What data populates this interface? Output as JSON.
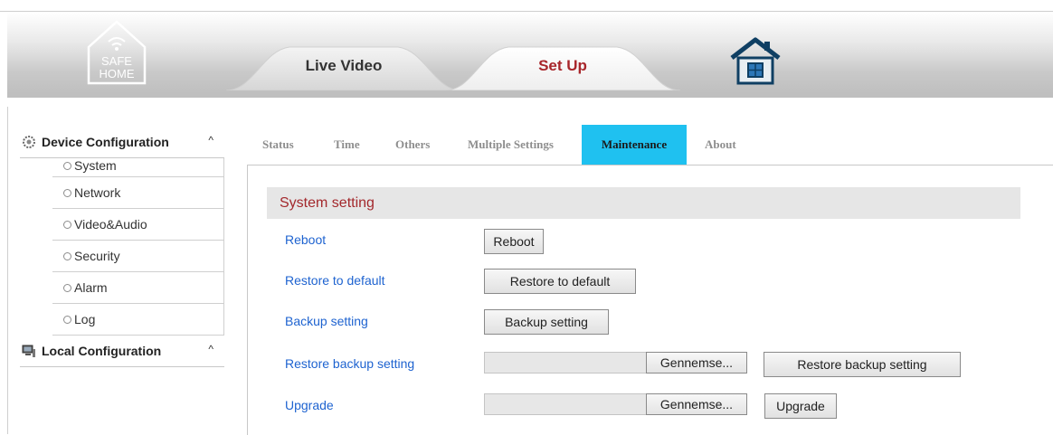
{
  "header": {
    "logo_text_line1": "SAFE",
    "logo_text_line2": "HOME",
    "tabs": [
      {
        "label": "Live Video"
      },
      {
        "label": "Set Up"
      }
    ]
  },
  "sidebar": {
    "device_configuration": {
      "label": "Device Configuration",
      "caret": "^",
      "items": [
        {
          "label": "System"
        },
        {
          "label": "Network"
        },
        {
          "label": "Video&Audio"
        },
        {
          "label": "Security"
        },
        {
          "label": "Alarm"
        },
        {
          "label": "Log"
        }
      ]
    },
    "local_configuration": {
      "label": "Local Configuration",
      "caret": "^"
    }
  },
  "subtabs": [
    {
      "label": "Status"
    },
    {
      "label": "Time"
    },
    {
      "label": "Others"
    },
    {
      "label": "Multiple Settings"
    },
    {
      "label": "Maintenance",
      "active": true
    },
    {
      "label": "About"
    }
  ],
  "section": {
    "title": "System setting"
  },
  "rows": {
    "reboot": {
      "label": "Reboot",
      "button": "Reboot"
    },
    "restore_default": {
      "label": "Restore to default",
      "button": "Restore to default"
    },
    "backup": {
      "label": "Backup setting",
      "button": "Backup setting"
    },
    "restore_backup": {
      "label": "Restore backup setting",
      "browse": "Gennemse...",
      "button": "Restore backup setting"
    },
    "upgrade": {
      "label": "Upgrade",
      "browse": "Gennemse...",
      "button": "Upgrade"
    }
  },
  "colors": {
    "accent_tab": "#1fc1f0",
    "section_title": "#a3282c",
    "link_blue": "#1e63d0",
    "setup_tab_text": "#a8262b"
  },
  "icons": {
    "logo": "safe-home-logo-icon",
    "home": "home-icon",
    "device_config": "gear-cluster-icon",
    "local_config": "computer-icon",
    "list_bullet": "radio-dot-icon"
  }
}
